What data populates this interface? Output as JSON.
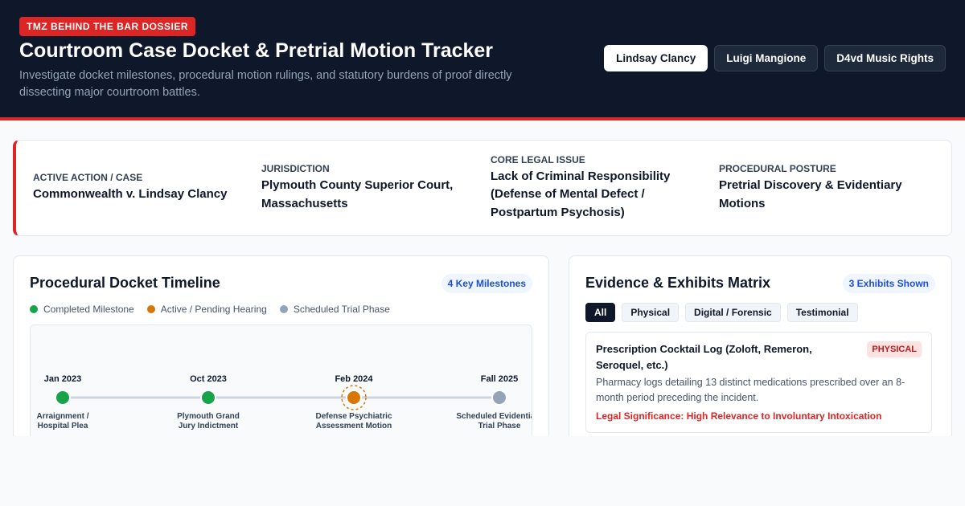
{
  "header": {
    "badge": "TMZ BEHIND THE BAR DOSSIER",
    "title": "Courtroom Case Docket & Pretrial Motion Tracker",
    "subtitle": "Investigate docket milestones, procedural motion rulings, and statutory burdens of proof directly dissecting major courtroom battles.",
    "case_tabs": [
      "Lindsay Clancy",
      "Luigi Mangione",
      "D4vd Music Rights"
    ],
    "active_tab": "Lindsay Clancy"
  },
  "summary": {
    "case": {
      "label": "Active Action / Case",
      "value": "Commonwealth v. Lindsay Clancy"
    },
    "jurisdiction": {
      "label": "Jurisdiction",
      "value": "Plymouth County Superior Court, Massachusetts"
    },
    "issue": {
      "label": "Core Legal Issue",
      "value": "Lack of Criminal Responsibility (Defense of Mental Defect / Postpartum Psychosis)"
    },
    "posture": {
      "label": "Procedural Posture",
      "value": "Pretrial Discovery & Evidentiary Motions"
    }
  },
  "timeline": {
    "title": "Procedural Docket Timeline",
    "count_badge": "4 Key Milestones",
    "legend": [
      {
        "label": "Completed Milestone",
        "color": "#16a34a"
      },
      {
        "label": "Active / Pending Hearing",
        "color": "#d97706"
      },
      {
        "label": "Scheduled Trial Phase",
        "color": "#94a3b8"
      }
    ],
    "milestones": [
      {
        "date": "Jan 2023",
        "label_lines": [
          "Arraignment /",
          "Hospital Plea"
        ],
        "status": "completed"
      },
      {
        "date": "Oct 2023",
        "label_lines": [
          "Plymouth Grand",
          "Jury Indictment"
        ],
        "status": "completed"
      },
      {
        "date": "Feb 2024",
        "label_lines": [
          "Defense Psychiatric",
          "Assessment Motion"
        ],
        "status": "active"
      },
      {
        "date": "Fall 2025",
        "label_lines": [
          "Scheduled Evidentiary",
          "Trial Phase"
        ],
        "status": "scheduled"
      }
    ]
  },
  "evidence": {
    "title": "Evidence & Exhibits Matrix",
    "count_badge": "3 Exhibits Shown",
    "filters": [
      "All",
      "Physical",
      "Digital / Forensic",
      "Testimonial"
    ],
    "active_filter": "All",
    "exhibits": [
      {
        "title": "Prescription Cocktail Log (Zoloft, Remeron, Seroquel, etc.)",
        "tag": "PHYSICAL",
        "description": "Pharmacy logs detailing 13 distinct medications prescribed over an 8-month period preceding the incident.",
        "significance": "Legal Significance: High Relevance to Involuntary Intoxication"
      }
    ]
  }
}
